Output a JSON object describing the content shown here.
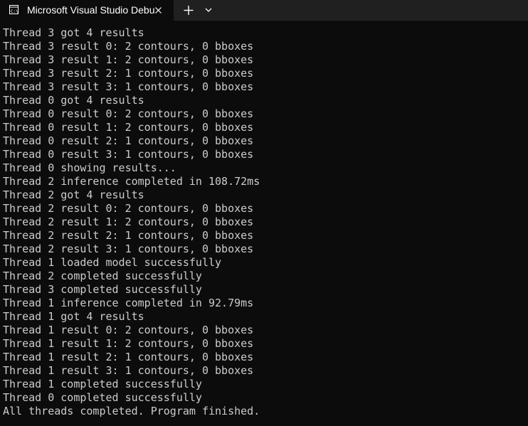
{
  "window": {
    "tab_title": "Microsoft Visual Studio Debug Console",
    "tab_icon": "console-window-icon",
    "close_icon": "close-icon",
    "new_tab_icon": "plus-icon",
    "dropdown_icon": "chevron-down-icon"
  },
  "colors": {
    "console_background": "#0c0c0c",
    "console_text": "#cccccc",
    "tab_strip_background": "#202020",
    "tab_title_text": "#ffffff"
  },
  "console": {
    "lines": [
      "Thread 3 got 4 results",
      "Thread 3 result 0: 2 contours, 0 bboxes",
      "Thread 3 result 1: 2 contours, 0 bboxes",
      "Thread 3 result 2: 1 contours, 0 bboxes",
      "Thread 3 result 3: 1 contours, 0 bboxes",
      "Thread 0 got 4 results",
      "Thread 0 result 0: 2 contours, 0 bboxes",
      "Thread 0 result 1: 2 contours, 0 bboxes",
      "Thread 0 result 2: 1 contours, 0 bboxes",
      "Thread 0 result 3: 1 contours, 0 bboxes",
      "Thread 0 showing results...",
      "Thread 2 inference completed in 108.72ms",
      "Thread 2 got 4 results",
      "Thread 2 result 0: 2 contours, 0 bboxes",
      "Thread 2 result 1: 2 contours, 0 bboxes",
      "Thread 2 result 2: 1 contours, 0 bboxes",
      "Thread 2 result 3: 1 contours, 0 bboxes",
      "Thread 1 loaded model successfully",
      "Thread 2 completed successfully",
      "Thread 3 completed successfully",
      "Thread 1 inference completed in 92.79ms",
      "Thread 1 got 4 results",
      "Thread 1 result 0: 2 contours, 0 bboxes",
      "Thread 1 result 1: 2 contours, 0 bboxes",
      "Thread 1 result 2: 1 contours, 0 bboxes",
      "Thread 1 result 3: 1 contours, 0 bboxes",
      "Thread 1 completed successfully",
      "Thread 0 completed successfully",
      "All threads completed. Program finished."
    ]
  }
}
